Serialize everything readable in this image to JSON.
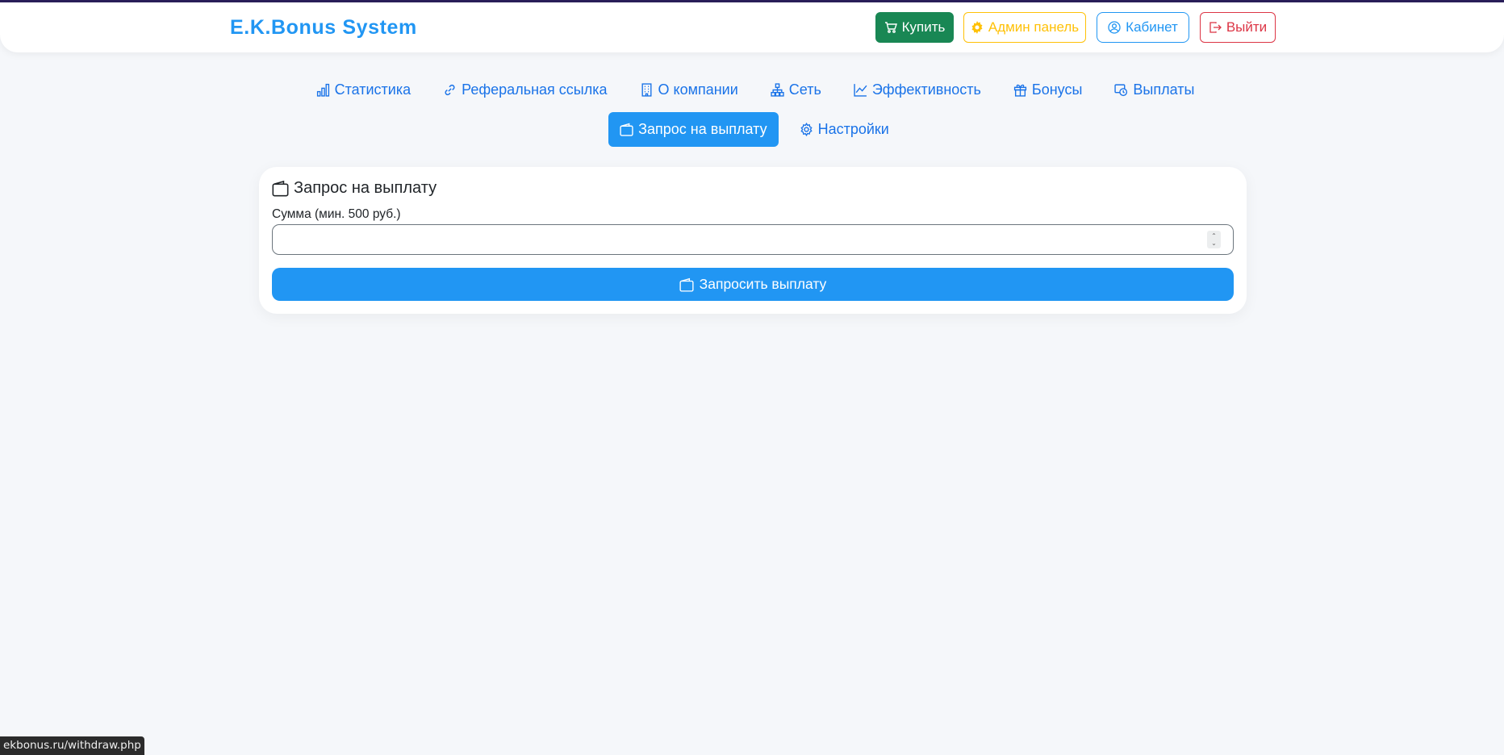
{
  "header": {
    "brand": "E.K.Bonus System",
    "buy_label": "Купить",
    "admin_label": "Админ панель",
    "cabinet_label": "Кабинет",
    "logout_label": "Выйти"
  },
  "tabs": [
    {
      "label": "Статистика",
      "icon": "bar-chart-icon"
    },
    {
      "label": "Реферальная ссылка",
      "icon": "link-icon"
    },
    {
      "label": "О компании",
      "icon": "building-icon"
    },
    {
      "label": "Сеть",
      "icon": "network-icon"
    },
    {
      "label": "Эффективность",
      "icon": "line-chart-icon"
    },
    {
      "label": "Бонусы",
      "icon": "gift-icon"
    },
    {
      "label": "Выплаты",
      "icon": "payments-icon"
    },
    {
      "label": "Запрос на выплату",
      "icon": "wallet-icon",
      "active": true
    },
    {
      "label": "Настройки",
      "icon": "gear-icon"
    }
  ],
  "card": {
    "title": "Запрос на выплату",
    "amount_label": "Сумма (мин. 500 руб.)",
    "amount_value": "",
    "submit_label": "Запросить выплату"
  },
  "statusbar": {
    "url": "ekbonus.ru/withdraw.php"
  },
  "colors": {
    "accent": "#2196f3",
    "buy": "#198754",
    "admin": "#ffc107",
    "logout": "#dc3545",
    "background": "#f5f7fa"
  }
}
